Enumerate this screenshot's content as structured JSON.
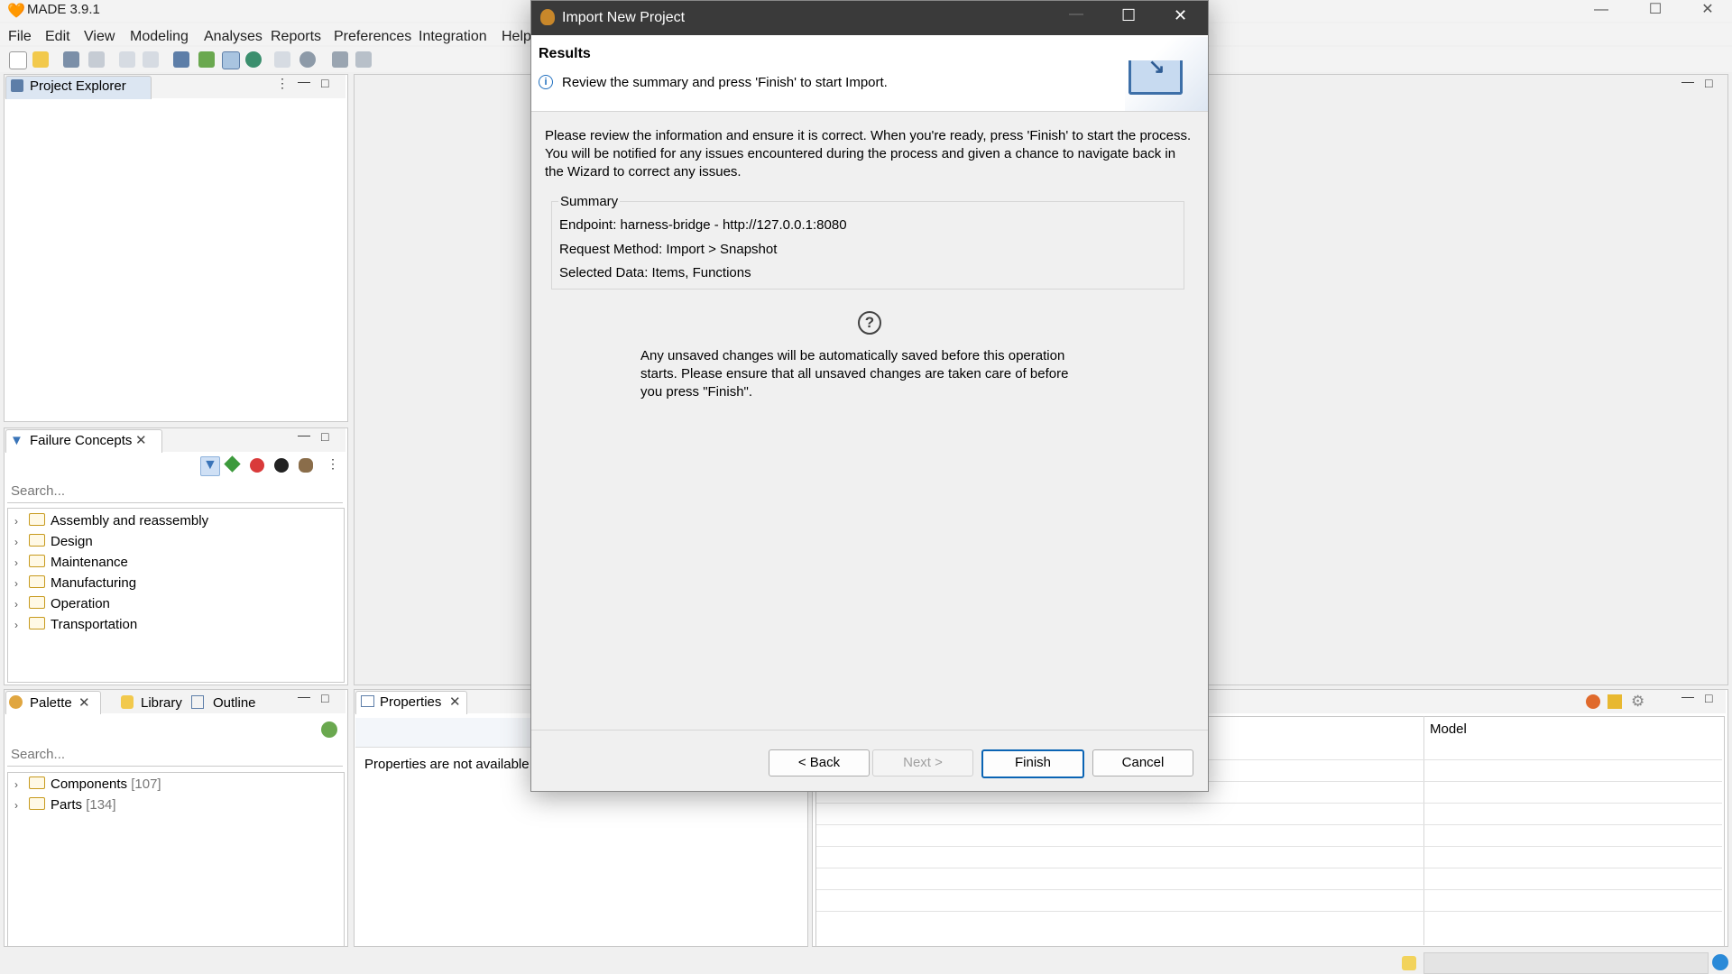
{
  "app": {
    "title": "MADE 3.9.1"
  },
  "menu": [
    "File",
    "Edit",
    "View",
    "Modeling",
    "Analyses",
    "Reports",
    "Preferences",
    "Integration",
    "Help"
  ],
  "project_explorer": {
    "title": "Project Explorer"
  },
  "failure_concepts": {
    "title": "Failure Concepts",
    "search_placeholder": "Search...",
    "items": [
      "Assembly and reassembly",
      "Design",
      "Maintenance",
      "Manufacturing",
      "Operation",
      "Transportation"
    ]
  },
  "palette": {
    "tabs": [
      "Palette",
      "Library",
      "Outline"
    ],
    "search_placeholder": "Search...",
    "items": [
      {
        "label": "Components",
        "count": "[107]"
      },
      {
        "label": "Parts",
        "count": "[134]"
      }
    ]
  },
  "properties": {
    "tab": "Properties",
    "message": "Properties are not available"
  },
  "problems_table": {
    "column_model": "Model"
  },
  "dialog": {
    "title": "Import New Project",
    "header_title": "Results",
    "header_message": "Review the summary and press 'Finish' to start Import.",
    "intro": "Please review the information and ensure it is correct. When you're ready, press 'Finish' to start the process. You will be notified for any issues encountered during the process and given a chance to navigate back in the Wizard to correct any issues.",
    "summary": {
      "label": "Summary",
      "endpoint": "Endpoint: harness-bridge - http://127.0.0.1:8080",
      "method": "Request Method: Import > Snapshot",
      "data": "Selected Data: Items, Functions"
    },
    "note": "Any unsaved changes will be automatically saved before this operation starts. Please ensure that all unsaved changes are taken care of before you press \"Finish\".",
    "buttons": {
      "back": "< Back",
      "next": "Next >",
      "finish": "Finish",
      "cancel": "Cancel"
    }
  },
  "colors": {
    "accent": "#0a64b4",
    "folder": "#c79a1d",
    "dialog_titlebar": "#3a3a3a"
  }
}
